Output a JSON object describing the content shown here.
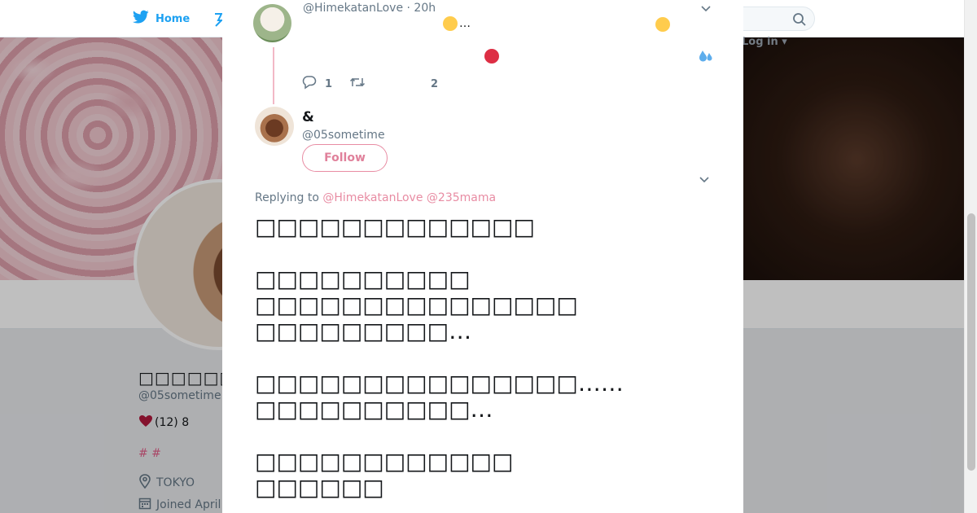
{
  "nav": {
    "home_label": "Home",
    "login_label": "Log in"
  },
  "profile": {
    "name": "□□□□□□□□",
    "handle": "@05sometime",
    "bio": "(12) 8",
    "tags": "# #",
    "location": "TOKYO",
    "joined": "Joined April"
  },
  "modal": {
    "prev_tweet": {
      "meta": "@HimekatanLove · 20h",
      "text": "…",
      "reply_count": "1",
      "like_count": "2"
    },
    "tweet": {
      "name": "&",
      "handle": "@05sometime",
      "follow_label": "Follow",
      "replying_prefix": "Replying to",
      "replying_mentions": "@HimekatanLove @235mama",
      "paragraphs": [
        [
          "□□□□□□□□□□□□□"
        ],
        [
          "□□□□□□□□□□",
          "□□□□□□□□□□□□□□□",
          "□□□□□□□□□…"
        ],
        [
          "□□□□□□□□□□□□□□□……",
          "□□□□□□□□□□…"
        ],
        [
          "□□□□□□□□□□□□",
          "□□□□□□"
        ]
      ]
    }
  },
  "colors": {
    "accent": "#1da1f2",
    "pink": "#e88ca3",
    "text": "#14171a",
    "muted": "#657786"
  }
}
